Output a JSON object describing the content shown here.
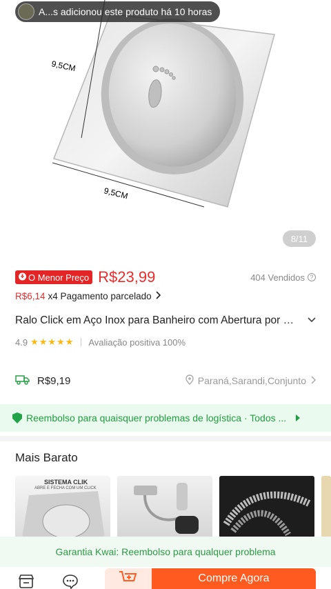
{
  "toast": {
    "text": "A...s adicionou este produto há 10 horas"
  },
  "gallery": {
    "counter": "8/11",
    "dim_left": "9,5CM",
    "dim_bottom": "9,5CM"
  },
  "price": {
    "badge": "O Menor Preço",
    "value": "R$23,99",
    "sold": "404 Vendidos",
    "installment_value": "R$6,14",
    "installment_text": "x4 Pagamento parcelado"
  },
  "product": {
    "title": "Ralo Click em Aço Inox para Banheiro com Abertura por Pressão",
    "rating": "4.9",
    "stars": 4.9,
    "positive": "Avaliação positiva 100%"
  },
  "shipping": {
    "fee": "R$9,19",
    "location": "Paraná,Sarandi,Conjunto"
  },
  "refund": {
    "text": "Reembolso para quaisquer problemas de logística · Todos ..."
  },
  "cheaper": {
    "title": "Mais Barato",
    "cards": [
      {
        "label": "SISTEMA CLIK",
        "sub": "ABRE E FECHA COM UM CLICK"
      },
      {
        "label": ""
      },
      {
        "label": ""
      }
    ]
  },
  "guarantee": {
    "text": "Garantia Kwai: Reembolso para qualquer problema"
  },
  "actions": {
    "buy": "Compre Agora"
  },
  "colors": {
    "accent": "#ff5a1f",
    "price": "#ee2a2a",
    "green": "#22a34a"
  }
}
